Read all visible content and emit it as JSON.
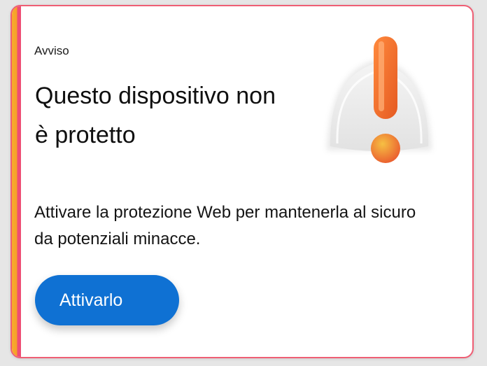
{
  "card": {
    "eyebrow": "Avviso",
    "title": "Questo dispositivo non è protetto",
    "description": "Attivare la protezione Web per mantenerla al sicuro da potenziali minacce.",
    "cta_label": "Attivarlo"
  },
  "illustration": {
    "icon": "bell-alert-icon"
  },
  "colors": {
    "button": "#0f71d3",
    "accent_orange": "#f7ab2c",
    "accent_pink": "#ee4d74",
    "alert_orange": "#f06a2c"
  }
}
